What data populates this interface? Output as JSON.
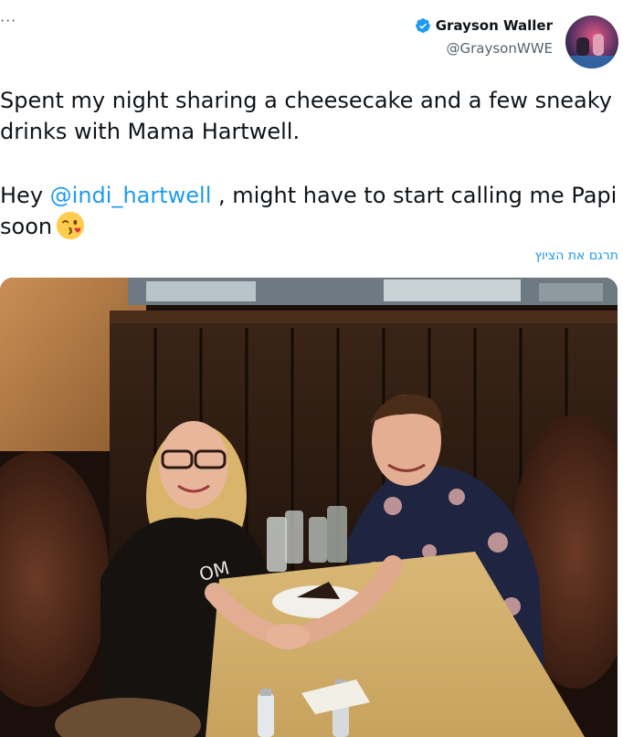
{
  "tweet": {
    "author": {
      "display_name": "Grayson Waller",
      "handle": "@GraysonWWE",
      "verified": true,
      "verified_color": "#1d9bf0"
    },
    "more_label": "···",
    "text": {
      "line1": "Spent my night sharing a cheesecake and a few sneaky drinks with Mama Hartwell.",
      "hey": "Hey ",
      "mention": "@indi_hartwell",
      "after_mention": " , might have to start calling me Papi soon",
      "emoji": "kiss-wink-emoji"
    },
    "translate_label": "תרגם את הציוץ",
    "photo": {
      "shirt_print": "OM"
    }
  },
  "colors": {
    "link": "#1d9bf0",
    "secondary_text": "#536471",
    "primary_text": "#0f1419"
  }
}
